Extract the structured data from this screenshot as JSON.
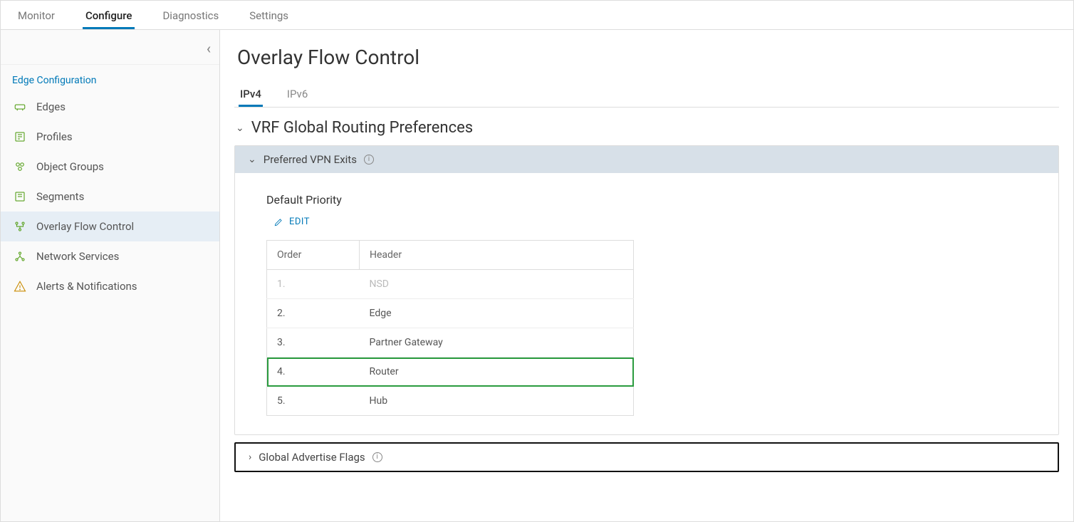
{
  "top_tabs": {
    "t0": "Monitor",
    "t1": "Configure",
    "t2": "Diagnostics",
    "t3": "Settings"
  },
  "sidebar": {
    "section_title": "Edge Configuration",
    "items": {
      "i0": "Edges",
      "i1": "Profiles",
      "i2": "Object Groups",
      "i3": "Segments",
      "i4": "Overlay Flow Control",
      "i5": "Network Services",
      "i6": "Alerts & Notifications"
    }
  },
  "page": {
    "title": "Overlay Flow Control",
    "sub_tabs": {
      "s0": "IPv4",
      "s1": "IPv6"
    },
    "section_header": "VRF Global Routing Preferences",
    "panels": {
      "preferred_exits": {
        "title": "Preferred VPN Exits",
        "subhead": "Default Priority",
        "edit_label": "EDIT",
        "table": {
          "cols": {
            "c0": "Order",
            "c1": "Header"
          },
          "rows": {
            "r0": {
              "order": "1.",
              "header": "NSD"
            },
            "r1": {
              "order": "2.",
              "header": "Edge"
            },
            "r2": {
              "order": "3.",
              "header": "Partner Gateway"
            },
            "r3": {
              "order": "4.",
              "header": "Router"
            },
            "r4": {
              "order": "5.",
              "header": "Hub"
            }
          }
        }
      },
      "global_flags": {
        "title": "Global Advertise Flags"
      }
    }
  }
}
